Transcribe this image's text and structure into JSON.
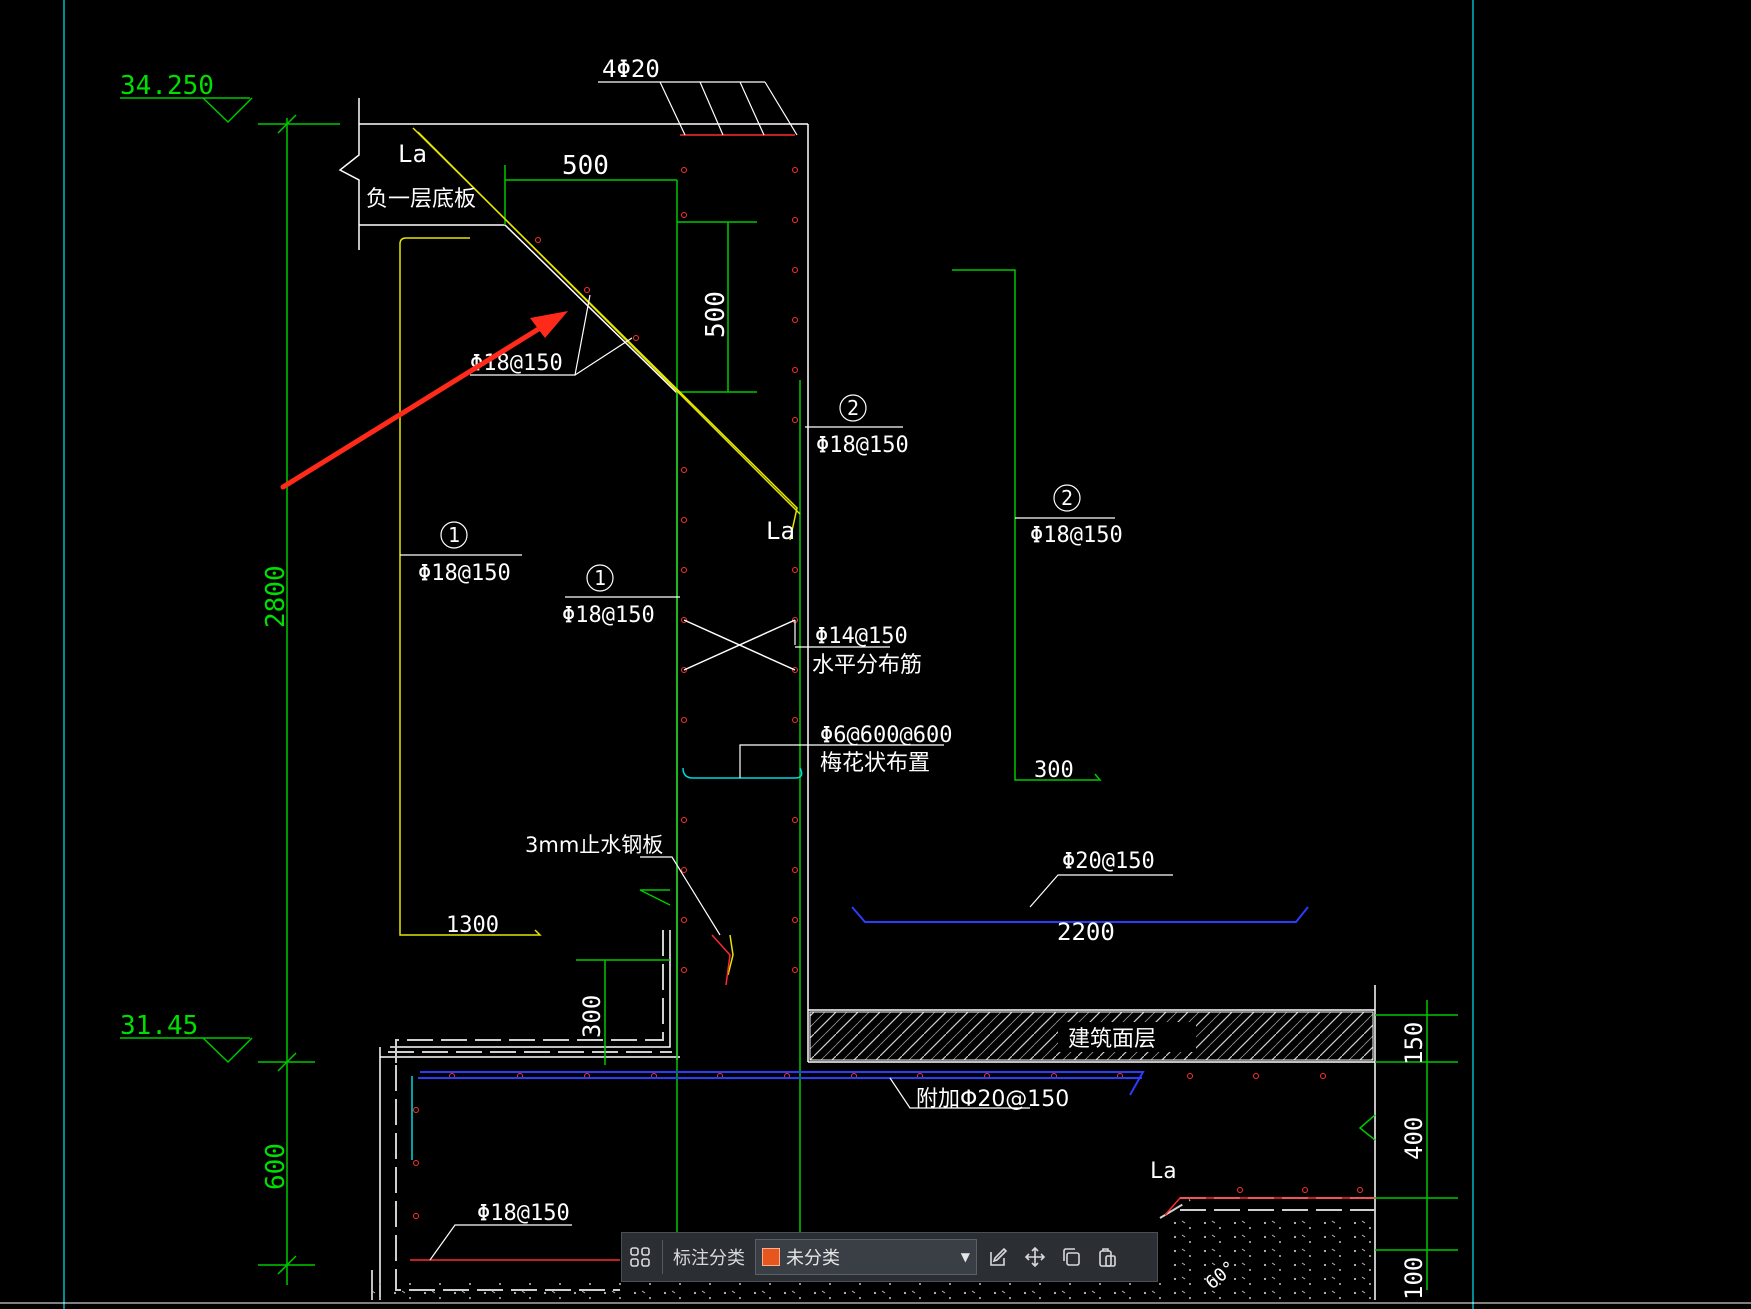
{
  "drawing": {
    "elevations": {
      "top": "34.250",
      "mid": "31.45"
    },
    "dimensions": {
      "wall_height": "2800",
      "base_height": "600",
      "slab_width": "500",
      "haunch_height": "500",
      "left_bar_length": "1300",
      "right_bar_length": "300",
      "kicker_height": "300",
      "bottom_bar_length": "2200",
      "layer_150": "150",
      "layer_400": "400",
      "layer_100": "100",
      "angle": "60°"
    },
    "labels": {
      "top_bars": "4Φ20",
      "anchorage": "La",
      "floor_slab": "负一层底板",
      "diagonal_bar": "Φ18@150",
      "bar1_mark": "1",
      "bar1_spec": "Φ18@150",
      "bar1b_spec": "Φ18@150",
      "bar2_mark": "2",
      "bar2_spec": "Φ18@150",
      "bar2b_spec": "Φ18@150",
      "horiz_bar": "Φ14@150",
      "horiz_bar_desc": "水平分布筋",
      "tie_bar": "Φ6@600@600",
      "tie_bar_desc": "梅花状布置",
      "water_stop": "3mm止水钢板",
      "bottom_bar": "Φ20@150",
      "finish_layer": "建筑面层",
      "additional_bar": "附加Φ20@150",
      "base_bar": "Φ18@150"
    }
  },
  "toolbar": {
    "label": "标注分类",
    "selected": "未分类",
    "category_color": "#e8561f"
  },
  "colors": {
    "background": "#000000",
    "dimension": "#00c800",
    "outline": "#ffffff",
    "yellow": "#e6e600",
    "red": "#ff2a2a",
    "blue": "#2b3cff",
    "cyan": "#00d8e0"
  }
}
